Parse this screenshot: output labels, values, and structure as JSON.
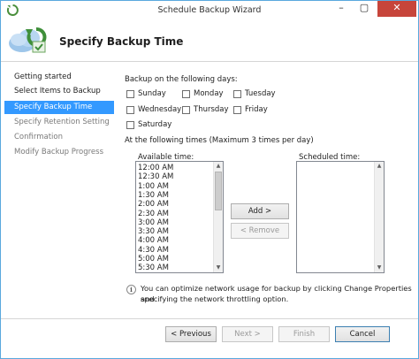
{
  "window": {
    "title": "Schedule Backup Wizard"
  },
  "header": {
    "title": "Specify Backup Time"
  },
  "sidebar": {
    "steps": [
      {
        "label": "Getting started"
      },
      {
        "label": "Select Items to Backup"
      },
      {
        "label": "Specify Backup Time"
      },
      {
        "label": "Specify Retention Setting"
      },
      {
        "label": "Confirmation"
      },
      {
        "label": "Modify Backup Progress"
      }
    ]
  },
  "days": {
    "label": "Backup on the following days:",
    "items": [
      {
        "label": "Sunday",
        "checked": false
      },
      {
        "label": "Monday",
        "checked": false
      },
      {
        "label": "Tuesday",
        "checked": false
      },
      {
        "label": "Wednesday",
        "checked": false
      },
      {
        "label": "Thursday",
        "checked": false
      },
      {
        "label": "Friday",
        "checked": false
      },
      {
        "label": "Saturday",
        "checked": false
      }
    ]
  },
  "times": {
    "label": "At the following times (Maximum 3 times per day)",
    "available_label": "Available time:",
    "scheduled_label": "Scheduled time:",
    "available": [
      "12:00 AM",
      "12:30 AM",
      "1:00 AM",
      "1:30 AM",
      "2:00 AM",
      "2:30 AM",
      "3:00 AM",
      "3:30 AM",
      "4:00 AM",
      "4:30 AM",
      "5:00 AM",
      "5:30 AM"
    ],
    "scheduled": [],
    "add_label": "Add >",
    "remove_label": "< Remove"
  },
  "info": {
    "text_line1": "You can optimize network usage for backup by clicking Change Properties and",
    "text_line2": "specifying the network throttling option."
  },
  "footer": {
    "previous_label": "< Previous",
    "next_label": "Next >",
    "finish_label": "Finish",
    "cancel_label": "Cancel"
  }
}
